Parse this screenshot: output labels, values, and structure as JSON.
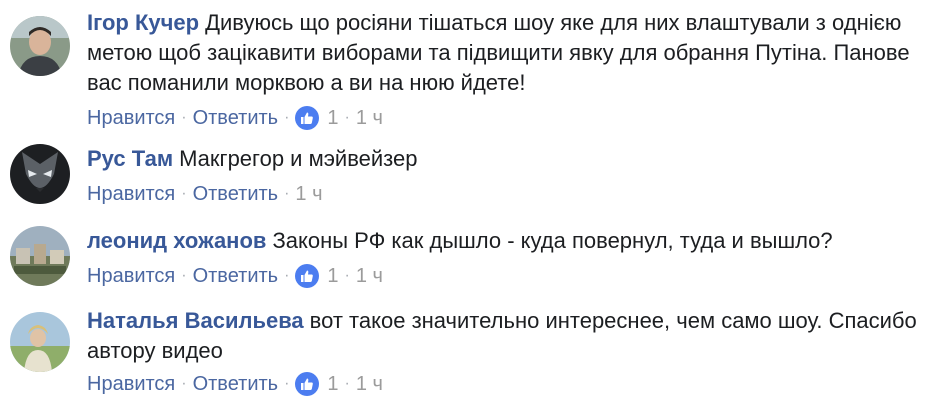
{
  "comments": [
    {
      "author": "Ігор Кучер",
      "text": "Дивуюсь що росіяни тішаться шоу яке для них влаштували з однією метою щоб зацікавити виборами та підвищити явку для обрання Путіна. Панове вас поманили морквою а ви на нюю йдете!",
      "like_label": "Нравится",
      "reply_label": "Ответить",
      "reactions": "1",
      "time": "1 ч",
      "avatar_icon": "avatar-photo-icon"
    },
    {
      "author": "Рус Там",
      "text": "Макгрегор и мэйвейзер",
      "like_label": "Нравится",
      "reply_label": "Ответить",
      "time": "1 ч",
      "avatar_icon": "avatar-photo-icon"
    },
    {
      "author": "леонид хожанов",
      "text": "Законы РФ как дышло - куда повернул, туда и вышло?",
      "like_label": "Нравится",
      "reply_label": "Ответить",
      "reactions": "1",
      "time": "1 ч",
      "avatar_icon": "avatar-photo-icon"
    },
    {
      "author": "Наталья Васильева",
      "text": "вот такое значительно интереснее, чем само шоу. Спасибо автору видео",
      "like_label": "Нравится",
      "reply_label": "Ответить",
      "reactions": "1",
      "time": "1 ч",
      "avatar_icon": "avatar-photo-icon"
    }
  ],
  "separator": "·",
  "colors": {
    "author": "#385898",
    "action": "#4b67a1",
    "meta": "#9b9b9b",
    "like_badge": "#4c7df0"
  }
}
